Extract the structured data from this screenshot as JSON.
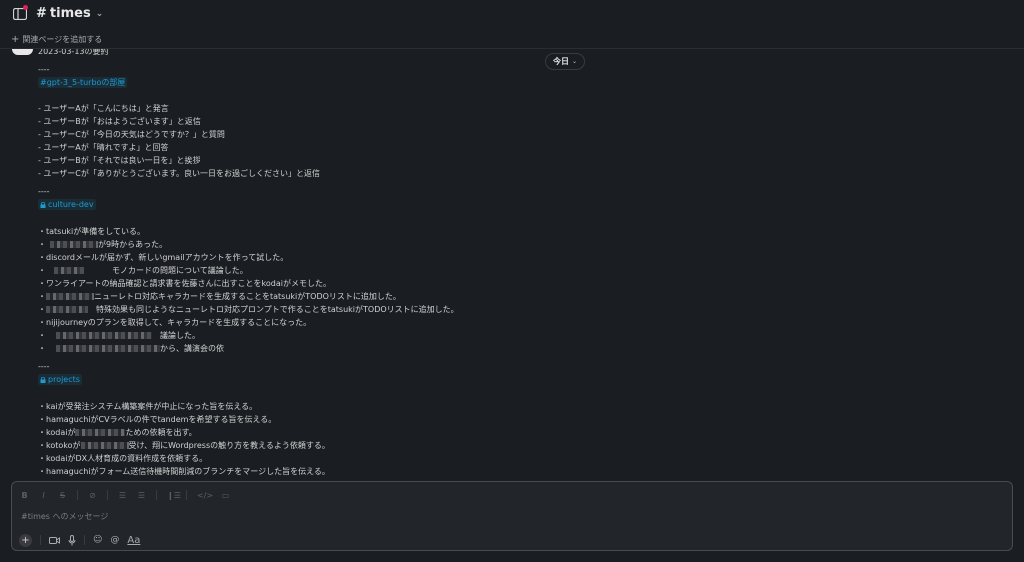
{
  "header": {
    "channel_hash": "#",
    "channel_name": "times",
    "chevron": "⌄",
    "sidebar_icon": "layout-icon"
  },
  "bookmark_bar": {
    "plus": "+",
    "add_label": "関連ページを追加する"
  },
  "messages": {
    "date_pill": "今日",
    "date_chevron": "⌄",
    "summary_title": "2023-03-13の要約",
    "sections": [
      {
        "separator": "----",
        "channel": "#gpt-3_5-turboの部屋",
        "lines": [
          "- ユーザーAが「こんにちは」と発言",
          "- ユーザーBが「おはようございます」と返信",
          "- ユーザーCが「今日の天気はどうですか？」と質問",
          "- ユーザーAが「晴れですよ」と回答",
          "- ユーザーBが「それでは良い一日を」と挨拶",
          "- ユーザーCが「ありがとうございます。良い一日をお過ごしください」と返信"
        ]
      },
      {
        "separator": "----",
        "channel": "culture-dev",
        "lines": [
          "・tatsukiが準備をしている。",
          "が9時からあった。",
          "・discordメールが届かず、新しいgmailアカウントを作って試した。",
          "モノカードの問題について議論した。",
          "・ワンライアートの納品確認と請求書を佐藤さんに出すことをkodaiがメモした。",
          "ニューレトロ対応キャラカードを生成することをtatsukiがTODOリストに追加した。",
          "特殊効果も同じようなニューレトロ対応プロンプトで作ることをtatsukiがTODOリストに追加した。",
          "・nijijourneyのプランを取得して、キャラカードを生成することになった。",
          "議論した。",
          "から、講演会の依"
        ]
      },
      {
        "separator": "----",
        "channel": "projects",
        "lines": [
          "・kaiが受発注システム構築案件が中止になった旨を伝える。",
          "・hamaguchiがCVラベルの件でtandemを希望する旨を伝える。",
          "ための依頼を出す。",
          "受け、翔にWordpressの触り方を教えるよう依頼する。",
          "・kodaiがDX人材育成の資料作成を依頼する。",
          "・hamaguchiがフォーム送信待機時間削減のブランチをマージした旨を伝える。"
        ]
      }
    ],
    "partial_prefixes": {
      "bullet": "・",
      "kodai_ga": "・kodaiが",
      "kotoko_ga": "・kotokoが"
    }
  },
  "composer": {
    "placeholder": "#times へのメッセージ",
    "format_icons": [
      "bold-icon",
      "italic-icon",
      "strikethrough-icon",
      "link-icon",
      "ordered-list-icon",
      "bullet-list-icon",
      "blockquote-icon",
      "code-icon",
      "code-block-icon"
    ],
    "format_glyphs": {
      "bold": "B",
      "italic": "I",
      "strike": "S",
      "link": "⊘",
      "ordered": "☰",
      "bullet": "☰",
      "quote": "❙☰",
      "code": "</>",
      "codeblock": "▭"
    },
    "tools": {
      "plus": "+",
      "video": "▭",
      "mic": "🎙",
      "emoji": "☺",
      "mention": "@",
      "format": "Aa"
    }
  },
  "colors": {
    "background": "#1a1d21",
    "link": "#1d9bd1",
    "notification_dot": "#e01e5a"
  }
}
